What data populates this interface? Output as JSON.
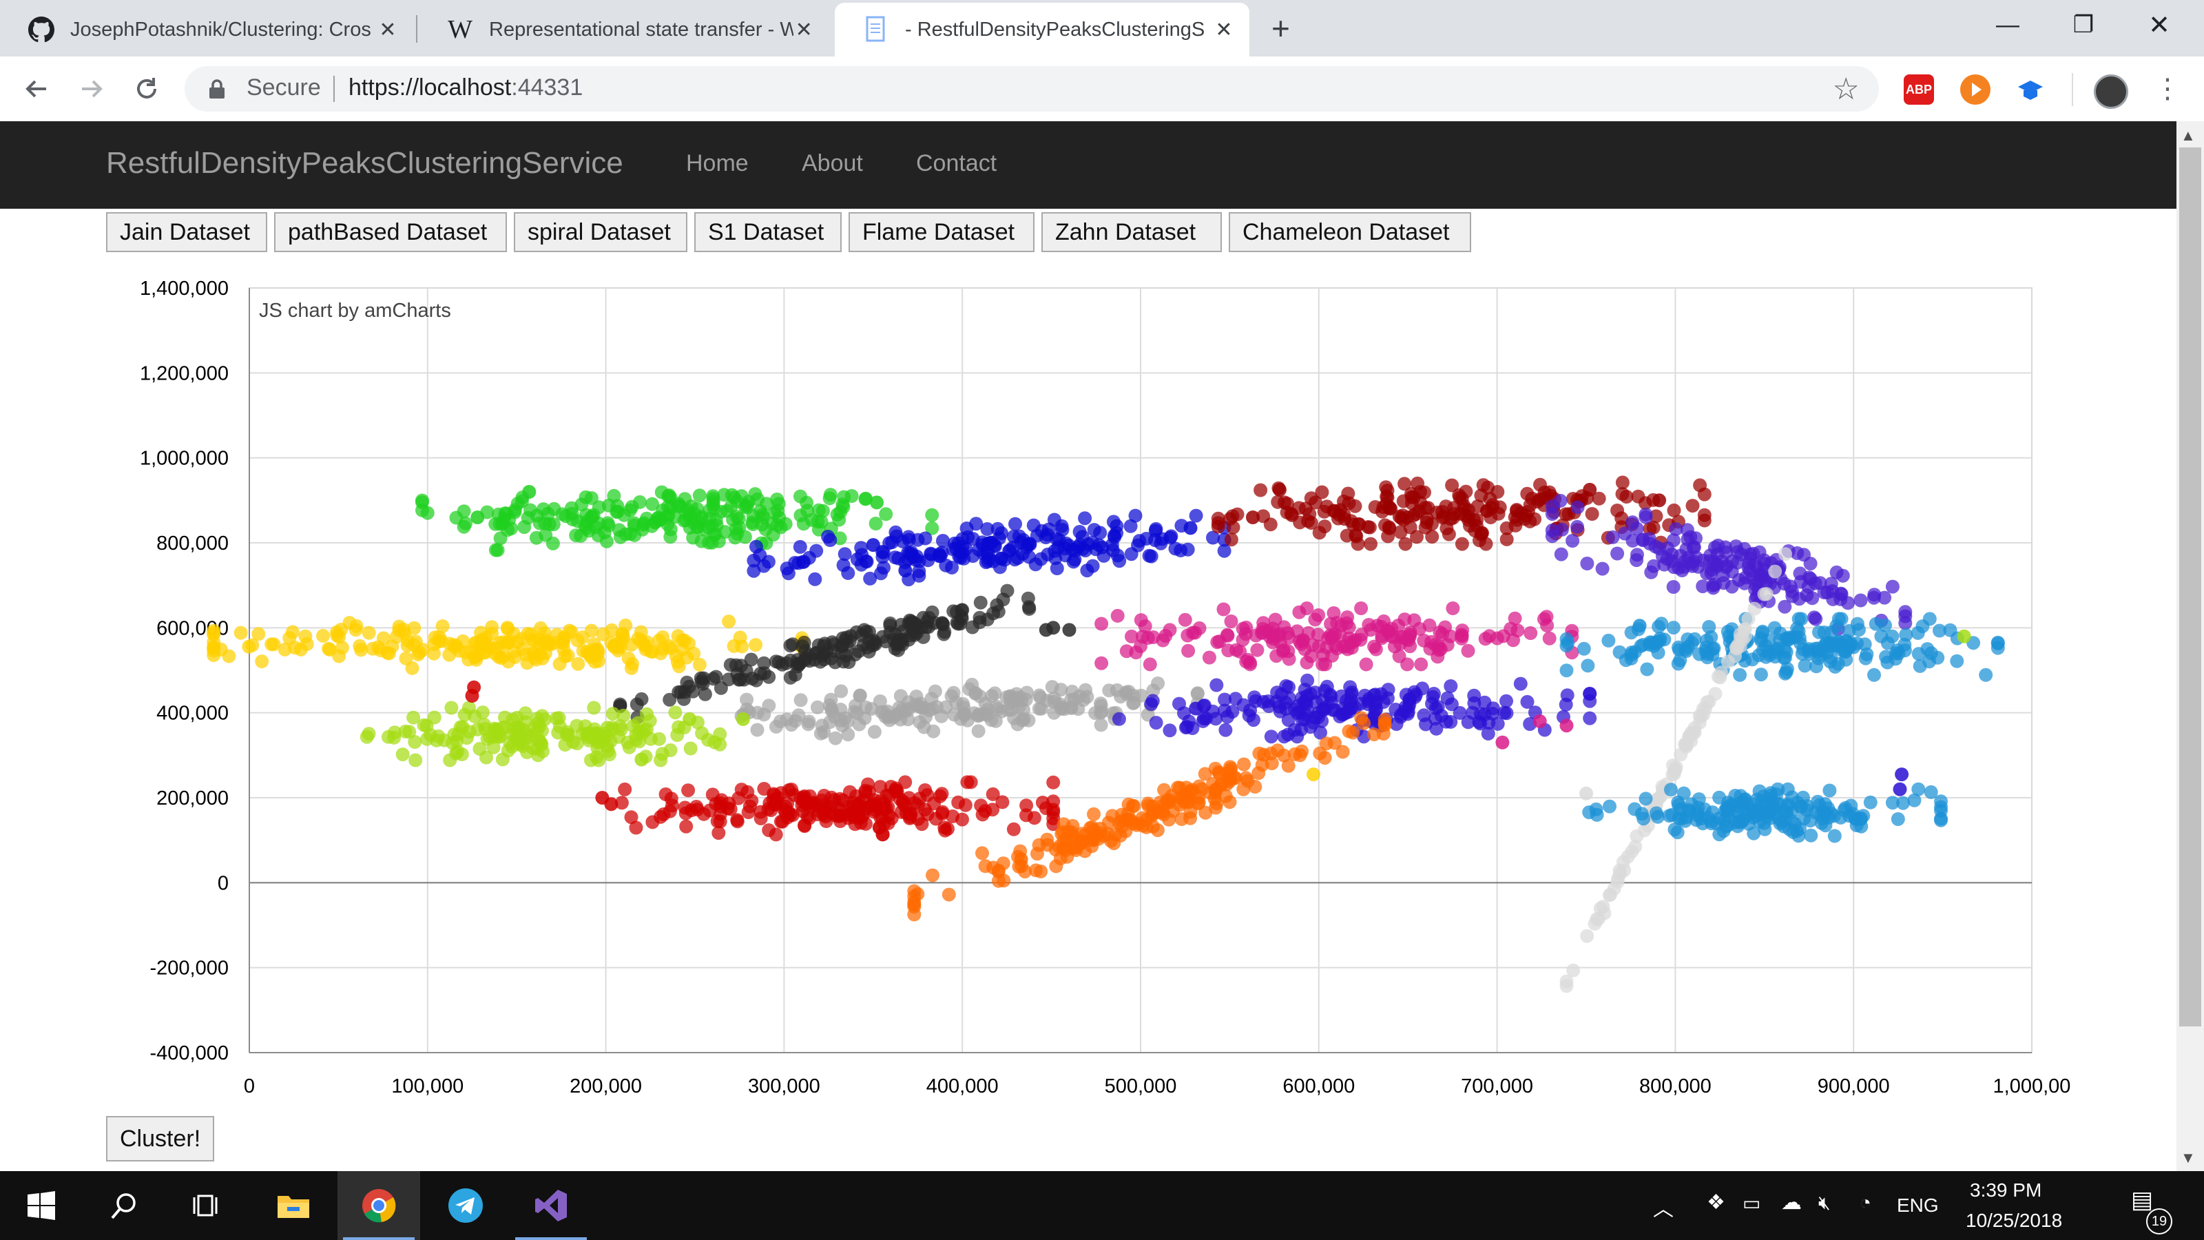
{
  "browser": {
    "tabs": [
      {
        "title": "JosephPotashnik/Clustering: Cros",
        "icon": "github-icon"
      },
      {
        "title": "Representational state transfer - W",
        "icon": "wikipedia-icon"
      },
      {
        "title": "- RestfulDensityPeaksClusteringS",
        "icon": "page-icon"
      }
    ],
    "omnibox": {
      "secure_label": "Secure",
      "url_host": "https://localhost",
      "url_port": ":44331"
    },
    "extensions": [
      "adblock-icon",
      "play-icon",
      "cap-icon",
      "avatar-icon"
    ]
  },
  "site": {
    "brand": "RestfulDensityPeaksClusteringService",
    "nav": [
      "Home",
      "About",
      "Contact"
    ],
    "dataset_buttons": [
      "Jain Dataset",
      "pathBased Dataset",
      "spiral Dataset",
      "S1 Dataset",
      "Flame Dataset",
      "Zahn Dataset",
      "Chameleon Dataset"
    ],
    "cluster_button": "Cluster!"
  },
  "chart_data": {
    "type": "scatter",
    "credit": "JS chart by amCharts",
    "xlim": [
      0,
      1000000
    ],
    "ylim": [
      -400000,
      1400000
    ],
    "x_ticks": [
      "0",
      "100,000",
      "200,000",
      "300,000",
      "400,000",
      "500,000",
      "600,000",
      "700,000",
      "800,000",
      "900,000",
      "1,000,00"
    ],
    "y_ticks": [
      "1,400,000",
      "1,200,000",
      "1,000,000",
      "800,000",
      "600,000",
      "400,000",
      "200,000",
      "0",
      "-200,000",
      "-400,000"
    ],
    "grid": true,
    "clusters": [
      {
        "color": "#1ed01e",
        "cx": 240000,
        "cy": 860000,
        "sx": 65000,
        "sy": 35000,
        "tilt": 0,
        "n": 220
      },
      {
        "color": "#0a0ad2",
        "cx": 415000,
        "cy": 785000,
        "sx": 60000,
        "sy": 28000,
        "tilt": 0.05,
        "n": 200
      },
      {
        "color": "#9b0000",
        "cx": 680000,
        "cy": 870000,
        "sx": 62000,
        "sy": 33000,
        "tilt": 0,
        "n": 210
      },
      {
        "color": "#4a1fd0",
        "cx": 830000,
        "cy": 740000,
        "sx": 45000,
        "sy": 35000,
        "tilt": -0.25,
        "n": 170
      },
      {
        "color": "#ffd000",
        "cx": 145000,
        "cy": 560000,
        "sx": 75000,
        "sy": 25000,
        "tilt": 0,
        "n": 220
      },
      {
        "color": "#2a2a2a",
        "cx": 340000,
        "cy": 560000,
        "sx": 60000,
        "sy": 18000,
        "tilt": 0.25,
        "n": 170
      },
      {
        "color": "#d81b89",
        "cx": 610000,
        "cy": 580000,
        "sx": 60000,
        "sy": 30000,
        "tilt": 0,
        "n": 180
      },
      {
        "color": "#1a90d6",
        "cx": 860000,
        "cy": 555000,
        "sx": 55000,
        "sy": 30000,
        "tilt": 0,
        "n": 200
      },
      {
        "color": "#a5dc14",
        "cx": 165000,
        "cy": 350000,
        "sx": 45000,
        "sy": 28000,
        "tilt": 0,
        "n": 170
      },
      {
        "color": "#a6a6a6",
        "cx": 400000,
        "cy": 410000,
        "sx": 60000,
        "sy": 25000,
        "tilt": 0.05,
        "n": 190
      },
      {
        "color": "#2a10d2",
        "cx": 620000,
        "cy": 410000,
        "sx": 60000,
        "sy": 30000,
        "tilt": 0,
        "n": 190
      },
      {
        "color": "#d9d9d9",
        "cx": 805000,
        "cy": 315000,
        "sx": 30000,
        "sy": 8000,
        "tilt": 1.1,
        "n": 90
      },
      {
        "color": "#d10000",
        "cx": 330000,
        "cy": 175000,
        "sx": 55000,
        "sy": 28000,
        "tilt": 0,
        "n": 220
      },
      {
        "color": "#ff6a00",
        "cx": 505000,
        "cy": 165000,
        "sx": 60000,
        "sy": 22000,
        "tilt": 0.35,
        "n": 200
      },
      {
        "color": "#1a90d6",
        "cx": 850000,
        "cy": 165000,
        "sx": 45000,
        "sy": 25000,
        "tilt": 0,
        "n": 180
      }
    ],
    "stray_points": [
      {
        "x": 128000,
        "y": 860000,
        "color": "#1ed01e"
      },
      {
        "x": 142000,
        "y": 845000,
        "color": "#1ed01e"
      },
      {
        "x": 157000,
        "y": 920000,
        "color": "#1ed01e"
      },
      {
        "x": 352000,
        "y": 895000,
        "color": "#1ed01e"
      },
      {
        "x": 350000,
        "y": 795000,
        "color": "#0a0ad2"
      },
      {
        "x": 368000,
        "y": 735000,
        "color": "#0a0ad2"
      },
      {
        "x": 528000,
        "y": 835000,
        "color": "#0a0ad2"
      },
      {
        "x": 563000,
        "y": 860000,
        "color": "#9b0000"
      },
      {
        "x": 578000,
        "y": 925000,
        "color": "#9b0000"
      },
      {
        "x": 752000,
        "y": 925000,
        "color": "#9b0000"
      },
      {
        "x": 791000,
        "y": 900000,
        "color": "#9b0000"
      },
      {
        "x": 962000,
        "y": 580000,
        "color": "#a5dc14"
      },
      {
        "x": 220000,
        "y": 290000,
        "color": "#a5dc14"
      },
      {
        "x": 247000,
        "y": 385000,
        "color": "#a5dc14"
      },
      {
        "x": 277000,
        "y": 385000,
        "color": "#a5dc14"
      },
      {
        "x": 447000,
        "y": 595000,
        "color": "#2a2a2a"
      },
      {
        "x": 451000,
        "y": 600000,
        "color": "#2a2a2a"
      },
      {
        "x": 460000,
        "y": 595000,
        "color": "#2a2a2a"
      },
      {
        "x": 126000,
        "y": 460000,
        "color": "#d10000"
      },
      {
        "x": 125000,
        "y": 440000,
        "color": "#d10000"
      },
      {
        "x": 198000,
        "y": 200000,
        "color": "#d10000"
      },
      {
        "x": 203000,
        "y": 185000,
        "color": "#d10000"
      },
      {
        "x": 433000,
        "y": 55000,
        "color": "#ff6a00"
      },
      {
        "x": 597000,
        "y": 255000,
        "color": "#ffd000"
      },
      {
        "x": 739000,
        "y": 370000,
        "color": "#d81b89"
      },
      {
        "x": 724000,
        "y": 380000,
        "color": "#d81b89"
      },
      {
        "x": 703000,
        "y": 330000,
        "color": "#d81b89"
      },
      {
        "x": 531000,
        "y": 410000,
        "color": "#2a10d2"
      },
      {
        "x": 927000,
        "y": 255000,
        "color": "#2a10d2"
      },
      {
        "x": 926000,
        "y": 220000,
        "color": "#2a10d2"
      },
      {
        "x": 750000,
        "y": 210000,
        "color": "#d9d9d9"
      },
      {
        "x": 780000,
        "y": 605000,
        "color": "#1a90d6"
      }
    ]
  },
  "taskbar": {
    "time": "3:39 PM",
    "date": "10/25/2018",
    "lang": "ENG",
    "notification_count": "19",
    "apps": [
      "start-icon",
      "search-icon",
      "task-view-icon",
      "file-explorer-icon",
      "chrome-icon",
      "telegram-icon",
      "visual-studio-icon"
    ]
  }
}
